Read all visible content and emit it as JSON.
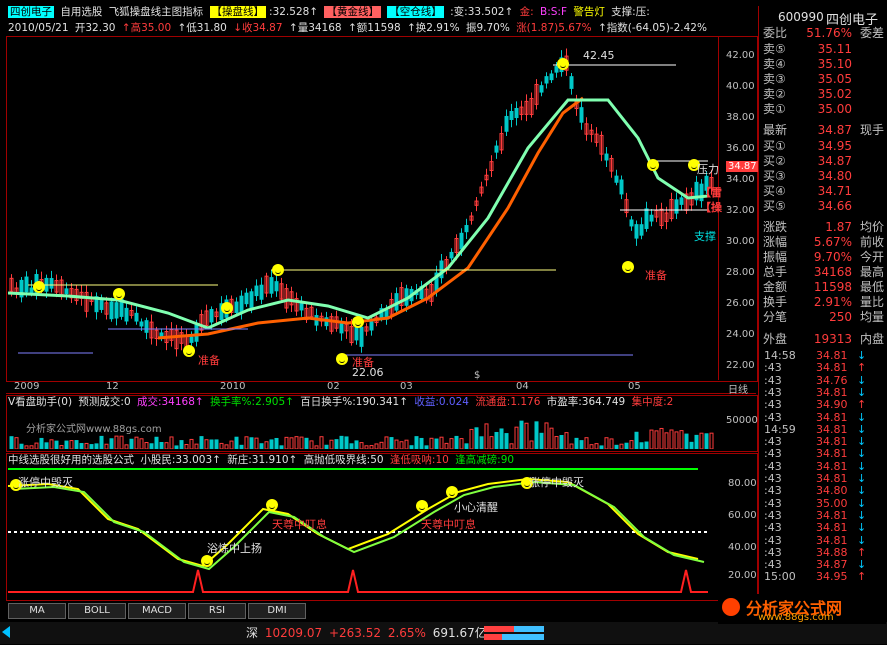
{
  "header": {
    "stock_name": "四创电子",
    "menu_custom": "自用选股",
    "indicator_title": "飞狐操盘线主图指标",
    "cao_pan_label": "【操盘线】",
    "cao_pan_val": ":32.528↑",
    "huang_jin_label": "【黄金线】",
    "kong_cang_label": "【空仓线】",
    "bian_label": ":变:33.502↑",
    "jin_label": "金:",
    "bs_label": "B:S:F",
    "alert_label": "警告灯",
    "support_label": "支撑:压:"
  },
  "quote_line": {
    "date": "2010/05/21",
    "open": "开32.30",
    "high": "↑高35.00",
    "low": "↑低31.80",
    "close": "↓收34.87",
    "volume": "↑量34168",
    "amount": "↑额11598",
    "turnover": "↑换2.91%",
    "amplitude": "振9.70%",
    "change": "涨(1.87)5.67%",
    "index": "↑指数(-64.05)-2.42%"
  },
  "price_axis": {
    "ticks": [
      "42.00",
      "40.00",
      "38.00",
      "36.00",
      "34.00",
      "32.00",
      "30.00",
      "28.00",
      "26.00",
      "24.00",
      "22.00"
    ],
    "current": "34.87"
  },
  "date_axis": {
    "labels": [
      "2009",
      "12",
      "2010",
      "02",
      "03",
      "04",
      "05"
    ],
    "suffix": "日线",
    "marker": "$"
  },
  "main_chart_labels": {
    "peak_label": "42.45",
    "low_label": "22.06",
    "pressure": "压力",
    "support": "支撑",
    "zhunbei": [
      "准备",
      "准备",
      "准备"
    ],
    "lei_label": "【雷",
    "cao_label": "【操"
  },
  "volume_panel": {
    "title": "V看盘助手(0)",
    "forecast": "预测成交:0",
    "trade_label": "成交:34168↑",
    "turnover_label": "换手率%:2.905↑",
    "hundred_day": "百日换手%:190.341↑",
    "profit_label": "收益:0.024",
    "circ_label": "流通盘:1.176",
    "pe_label": "市盈率:364.749",
    "conc_label": "集中度:2",
    "watermark": "分析家公式网www.88gs.com",
    "axis_tick": "50000"
  },
  "osc_panel": {
    "title": "中线选股很好用的选股公式",
    "small_holder": "小股民:33.003↑",
    "new_zhuang": "新庄:31.910↑",
    "absorb": "高抛低吸界线:50",
    "buy_label": "逢低吸呐:10",
    "sell_label": "逢高减磅:90",
    "ticks": [
      "80.00",
      "60.00",
      "40.00",
      "20.00"
    ],
    "tags": [
      "涨停中毁灭",
      "天尊中叮息",
      "小心清醒",
      "天尊中叮息",
      "涨停中毁灭",
      "浴炼中上扬"
    ]
  },
  "tabs": [
    "MA",
    "BOLL",
    "MACD",
    "RSI",
    "DMI"
  ],
  "status_bar": {
    "market": "深",
    "index_val": "10209.07",
    "change": "+263.52",
    "pct": "2.65%",
    "amount": "691.67亿"
  },
  "side_panel": {
    "code": "600990",
    "name": "四创电子",
    "wei_bi_label": "委比",
    "wei_bi_val": "51.76%",
    "wei_cha_label": "委差",
    "asks": [
      {
        "label": "卖⑤",
        "price": "35.11"
      },
      {
        "label": "卖④",
        "price": "35.10"
      },
      {
        "label": "卖③",
        "price": "35.05"
      },
      {
        "label": "卖②",
        "price": "35.02"
      },
      {
        "label": "卖①",
        "price": "35.00"
      }
    ],
    "latest_label": "最新",
    "latest_price": "34.87",
    "latest_right": "现手",
    "bids": [
      {
        "label": "买①",
        "price": "34.95"
      },
      {
        "label": "买②",
        "price": "34.87"
      },
      {
        "label": "买③",
        "price": "34.80"
      },
      {
        "label": "买④",
        "price": "34.71"
      },
      {
        "label": "买⑤",
        "price": "34.66"
      }
    ],
    "stats": [
      {
        "label": "涨跌",
        "val": "1.87",
        "right": "均价"
      },
      {
        "label": "涨幅",
        "val": "5.67%",
        "right": "前收"
      },
      {
        "label": "振幅",
        "val": "9.70%",
        "right": "今开"
      },
      {
        "label": "总手",
        "val": "34168",
        "right": "最高"
      },
      {
        "label": "金额",
        "val": "11598",
        "right": "最低"
      },
      {
        "label": "换手",
        "val": "2.91%",
        "right": "量比"
      },
      {
        "label": "分笔",
        "val": "250",
        "right": "均量"
      }
    ],
    "outer_label": "外盘",
    "outer_val": "19313",
    "inner_label": "内盘",
    "ticks": [
      {
        "time": "14:58",
        "price": "34.81",
        "arrow": "↓"
      },
      {
        "time": ":43",
        "price": "34.81",
        "arrow": "↑"
      },
      {
        "time": ":43",
        "price": "34.76",
        "arrow": "↓"
      },
      {
        "time": ":43",
        "price": "34.81",
        "arrow": "↓"
      },
      {
        "time": ":43",
        "price": "34.90",
        "arrow": "↑"
      },
      {
        "time": ":43",
        "price": "34.81",
        "arrow": "↓"
      },
      {
        "time": "14:59",
        "price": "34.81",
        "arrow": "↓"
      },
      {
        "time": ":43",
        "price": "34.81",
        "arrow": "↓"
      },
      {
        "time": ":43",
        "price": "34.81",
        "arrow": "↓"
      },
      {
        "time": ":43",
        "price": "34.81",
        "arrow": "↓"
      },
      {
        "time": ":43",
        "price": "34.81",
        "arrow": "↓"
      },
      {
        "time": ":43",
        "price": "34.80",
        "arrow": "↓"
      },
      {
        "time": ":43",
        "price": "35.00",
        "arrow": "↓"
      },
      {
        "time": ":43",
        "price": "34.81",
        "arrow": "↓"
      },
      {
        "time": ":43",
        "price": "34.81",
        "arrow": "↓"
      },
      {
        "time": ":43",
        "price": "34.81",
        "arrow": "↓"
      },
      {
        "time": ":43",
        "price": "34.88",
        "arrow": "↑"
      },
      {
        "time": ":43",
        "price": "34.87",
        "arrow": "↓"
      },
      {
        "time": "15:00",
        "price": "34.95",
        "arrow": "↑"
      }
    ]
  },
  "logo": {
    "text": "分析家公式网",
    "url_text": "www.88gs.com"
  },
  "colors": {
    "up": "#ff3c3c",
    "down": "#00c8c8",
    "bg": "#000000",
    "frame": "#a00000"
  }
}
